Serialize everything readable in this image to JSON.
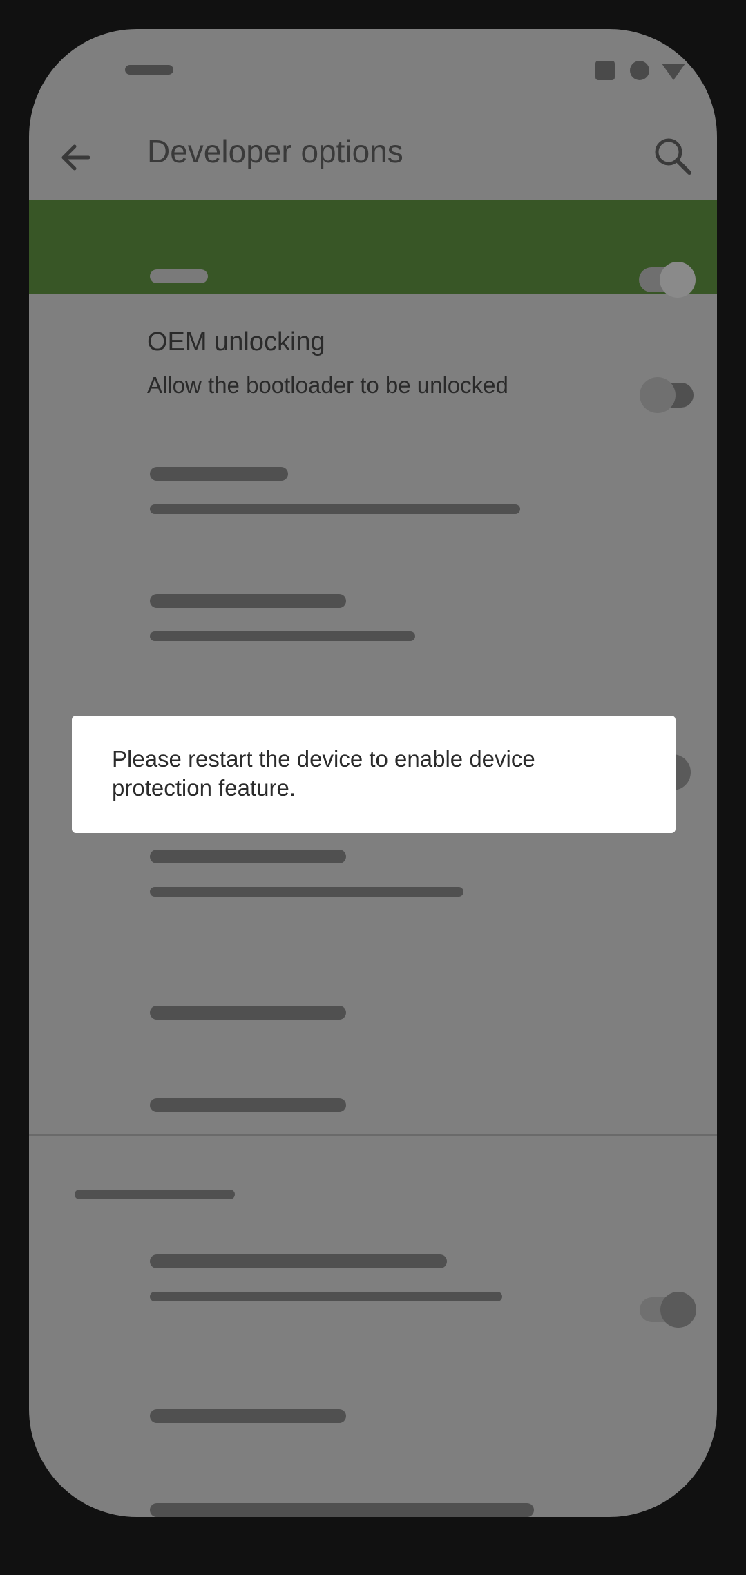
{
  "header": {
    "title": "Developer options"
  },
  "master_switch": {
    "state": "on"
  },
  "oem_unlocking": {
    "title": "OEM unlocking",
    "subtitle": "Allow the bootloader to be unlocked",
    "state": "off"
  },
  "dialog": {
    "message": "Please restart the device to enable device protection feature."
  },
  "colors": {
    "master_row": "#385626",
    "scrim": "#7f7f7f",
    "dialog_bg": "#ffffff"
  },
  "icons": [
    "back-arrow-icon",
    "search-icon",
    "recents-square-icon",
    "home-circle-icon",
    "back-triangle-icon"
  ]
}
